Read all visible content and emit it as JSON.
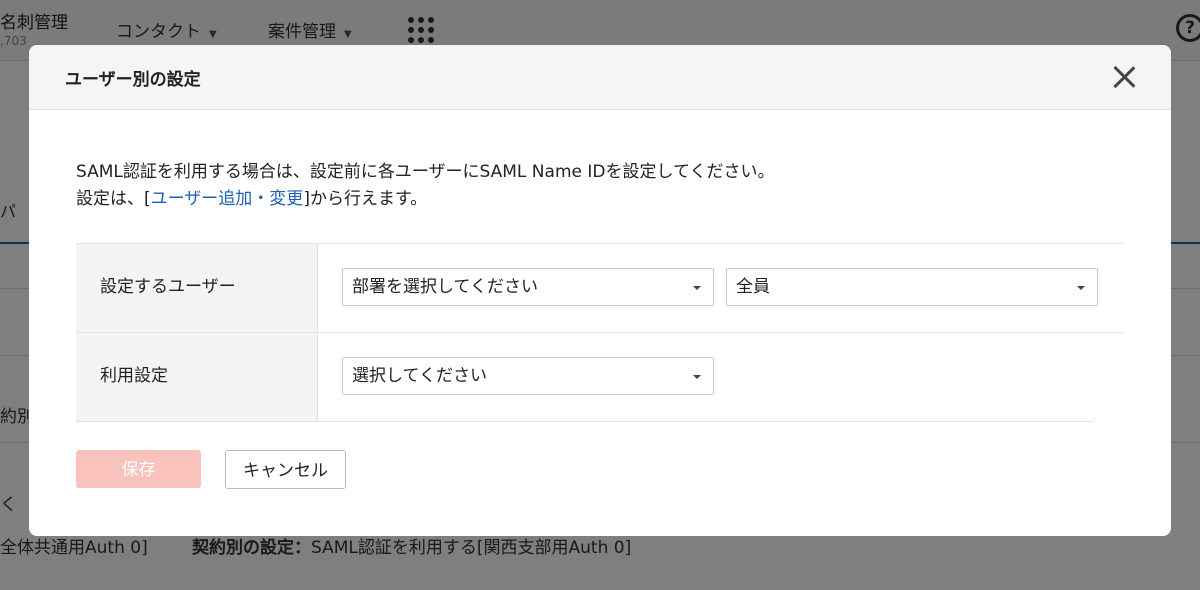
{
  "background": {
    "brand": "名刺管理",
    "brand_sub": ",703",
    "nav_contact": "コンタクト",
    "nav_deals": "案件管理",
    "tab_partial": "パ",
    "row_partial": "約別",
    "text_partial": "く",
    "footer_left": "全体共通用Auth 0]",
    "footer_bold": "契約別の設定：",
    "footer_rest": "SAML認証を利用する[関西支部用Auth 0]"
  },
  "modal": {
    "title": "ユーザー別の設定",
    "desc_line1": "SAML認証を利用する場合は、設定前に各ユーザーにSAML Name IDを設定してください。",
    "desc_line2_prefix": "設定は、[",
    "desc_link": "ユーザー追加・変更",
    "desc_line2_suffix": "]から行えます。",
    "rows": [
      {
        "label": "設定するユーザー"
      },
      {
        "label": "利用設定"
      }
    ],
    "dept_select": "部署を選択してください",
    "user_select": "全員",
    "use_select": "選択してください",
    "save_label": "保存",
    "cancel_label": "キャンセル"
  },
  "colors": {
    "link": "#1a62b8",
    "save_disabled": "#f9c2bd",
    "overlay": "rgba(0,0,0,0.5)"
  }
}
